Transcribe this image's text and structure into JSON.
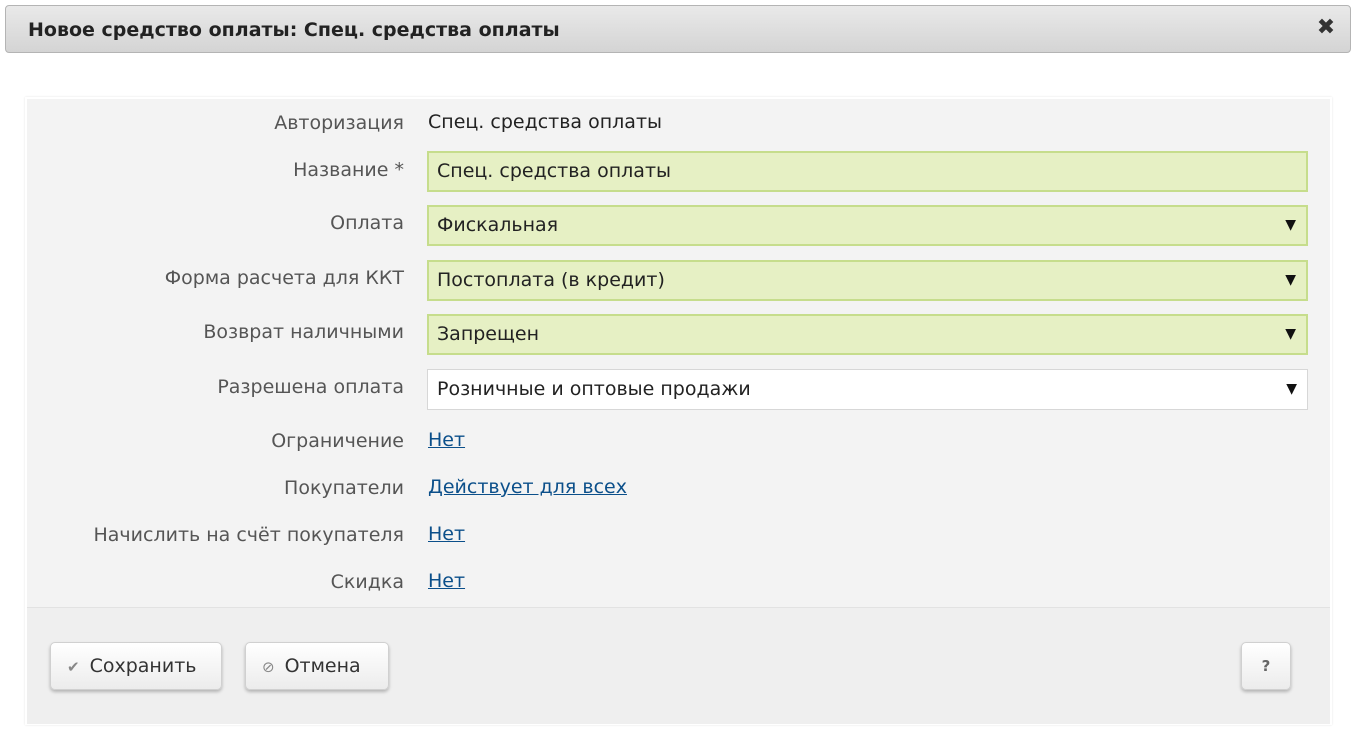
{
  "dialog": {
    "title": "Новое средство оплаты: Спец. средства оплаты",
    "close_icon": "✖"
  },
  "form": {
    "auth_label": "Авторизация",
    "auth_value": "Спец. средства оплаты",
    "name_label": "Название *",
    "name_value": "Спец. средства оплаты",
    "payment_label": "Оплата",
    "payment_value": "Фискальная",
    "kkt_label": "Форма расчета для ККТ",
    "kkt_value": "Постоплата (в кредит)",
    "refund_label": "Возврат наличными",
    "refund_value": "Запрещен",
    "allowed_label": "Разрешена оплата",
    "allowed_value": "Розничные и оптовые продажи",
    "limit_label": "Ограничение",
    "limit_value": "Нет",
    "buyers_label": "Покупатели",
    "buyers_value": "Действует для всех",
    "credit_label": "Начислить на счёт покупателя",
    "credit_value": "Нет",
    "discount_label": "Скидка",
    "discount_value": "Нет",
    "caret": "▼"
  },
  "footer": {
    "save_icon": "✔",
    "save_label": "Сохранить",
    "cancel_icon": "⊘",
    "cancel_label": "Отмена",
    "help_label": "?"
  },
  "icons": {
    "close": "close-icon",
    "save": "checkmark-icon",
    "cancel": "cancel-icon",
    "dropdown": "chevron-down-icon"
  },
  "colors": {
    "required_field_bg": "#e6f0c4",
    "required_field_border": "#c6dd8c",
    "link": "#0b4f8a"
  }
}
